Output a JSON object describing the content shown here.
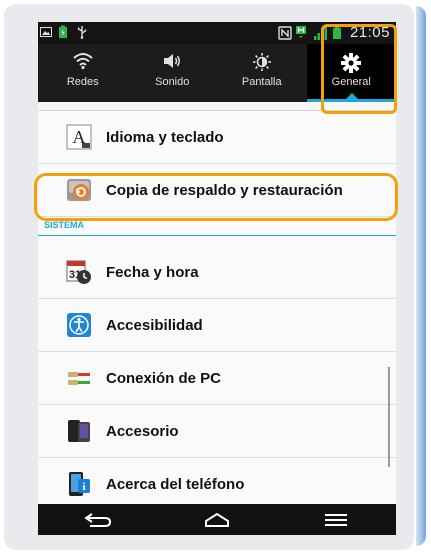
{
  "status_bar": {
    "time": "21:05",
    "icons": [
      "gallery-icon",
      "battery-charging-icon",
      "usb-icon",
      "nfc-icon",
      "h-signal-icon",
      "signal-icon",
      "battery-icon"
    ]
  },
  "tabs": [
    {
      "label": "Redes",
      "icon": "wifi-icon",
      "active": false
    },
    {
      "label": "Sonido",
      "icon": "speaker-icon",
      "active": false
    },
    {
      "label": "Pantalla",
      "icon": "brightness-icon",
      "active": false
    },
    {
      "label": "General",
      "icon": "gear-icon",
      "active": true
    }
  ],
  "settings": {
    "items_top": [
      {
        "label": "Idioma y teclado",
        "icon": "language-keyboard-icon"
      },
      {
        "label": "Copia de respaldo y restauración",
        "icon": "backup-restore-icon"
      }
    ],
    "section_title": "SISTEMA",
    "items_system": [
      {
        "label": "Fecha y hora",
        "icon": "calendar-clock-icon"
      },
      {
        "label": "Accesibilidad",
        "icon": "accessibility-icon"
      },
      {
        "label": "Conexión de PC",
        "icon": "pc-connection-icon"
      },
      {
        "label": "Accesorio",
        "icon": "accessory-icon"
      },
      {
        "label": "Acerca del teléfono",
        "icon": "about-phone-icon"
      }
    ]
  },
  "colors": {
    "accent": "#1ea7d6",
    "highlight": "#f3a10b"
  },
  "navigation": {
    "buttons": [
      "back-icon",
      "home-icon",
      "menu-icon"
    ]
  }
}
